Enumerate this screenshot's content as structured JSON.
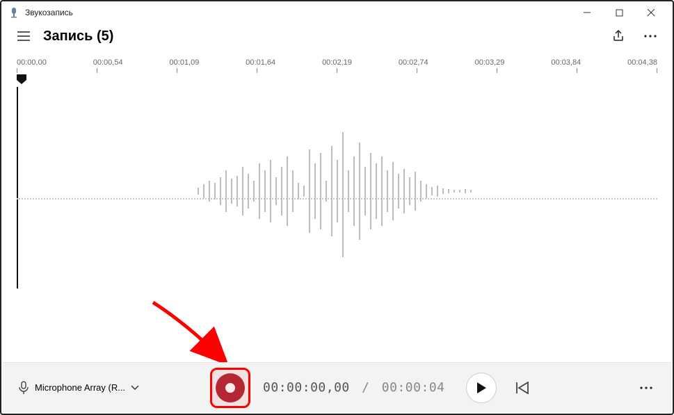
{
  "window": {
    "app_title": "Звукозапись"
  },
  "header": {
    "title": "Запись (5)"
  },
  "ruler": {
    "labels": [
      "00:00,00",
      "00:00,54",
      "00:01,09",
      "00:01,64",
      "00:02,19",
      "00:02,74",
      "00:03,29",
      "00:03,84",
      "00:04,38"
    ]
  },
  "footer": {
    "mic_label": "Microphone Array (R...",
    "elapsed": "00:00:00,00",
    "total": "00:00:04"
  },
  "colors": {
    "record": "#b02a37",
    "highlight": "#ff0000"
  }
}
